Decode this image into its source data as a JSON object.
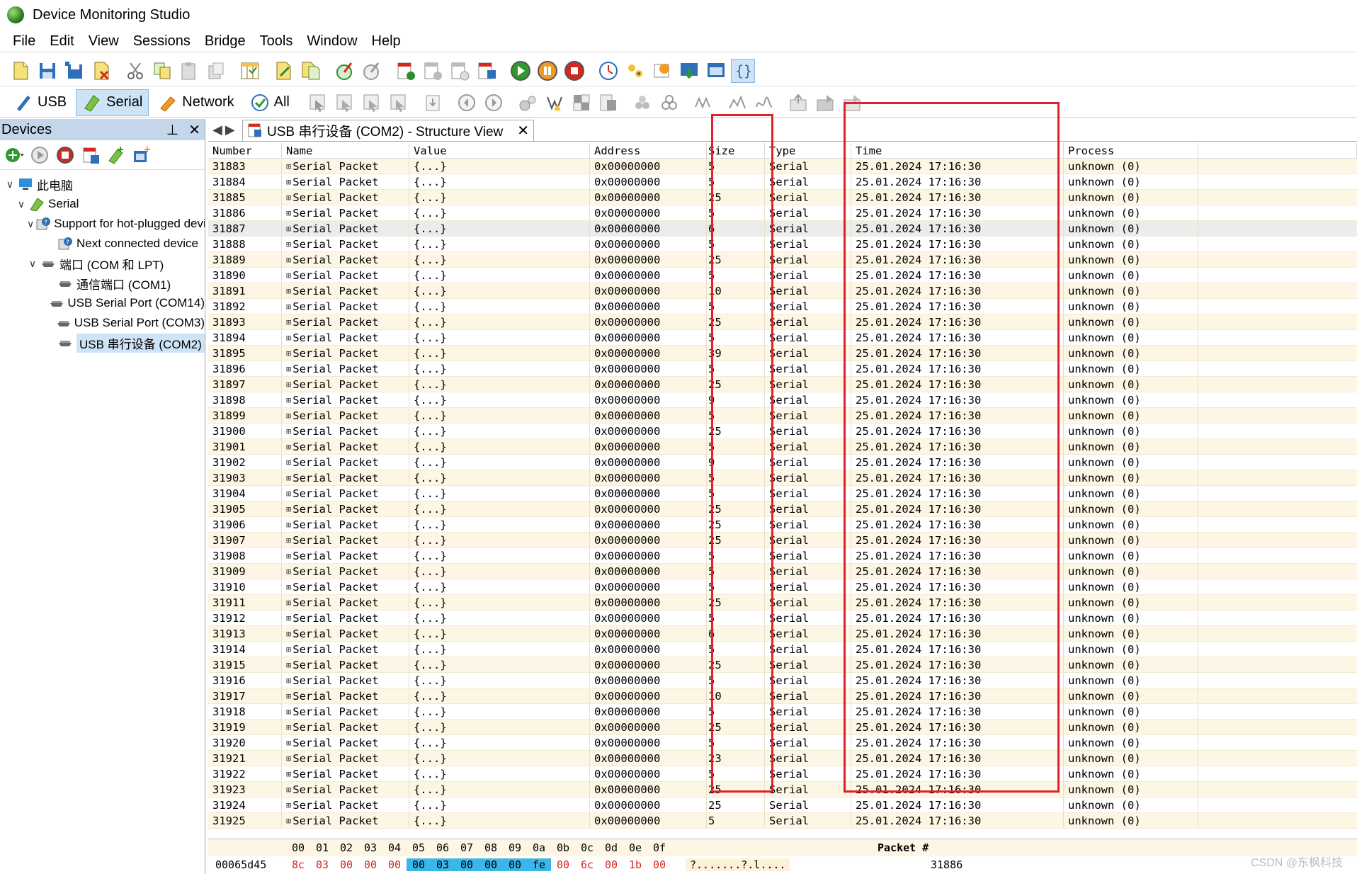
{
  "window": {
    "title": "Device Monitoring Studio"
  },
  "menu": [
    "File",
    "Edit",
    "View",
    "Sessions",
    "Bridge",
    "Tools",
    "Window",
    "Help"
  ],
  "filters": [
    {
      "label": "USB",
      "icon": "usb-icon",
      "active": false
    },
    {
      "label": "Serial",
      "icon": "serial-icon",
      "active": true
    },
    {
      "label": "Network",
      "icon": "network-icon",
      "active": false
    },
    {
      "label": "All",
      "icon": "check-all-icon",
      "active": false
    }
  ],
  "devices": {
    "header": "Devices",
    "pin": "⊥",
    "close": "✕",
    "tree": [
      {
        "label": "此电脑",
        "level": 0,
        "chev": "∨",
        "icon": "computer-icon"
      },
      {
        "label": "Serial",
        "level": 1,
        "chev": "∨",
        "icon": "serial-icon"
      },
      {
        "label": "Support for hot-plugged devices",
        "level": 2,
        "chev": "∨",
        "icon": "device-help-icon"
      },
      {
        "label": "Next connected device",
        "level": 3,
        "chev": "",
        "icon": "device-help-icon"
      },
      {
        "label": "端口 (COM 和 LPT)",
        "level": 2,
        "chev": "∨",
        "icon": "port-icon"
      },
      {
        "label": "通信端口 (COM1)",
        "level": 3,
        "chev": "",
        "icon": "port-icon"
      },
      {
        "label": "USB Serial Port (COM14)",
        "level": 3,
        "chev": "",
        "icon": "port-icon"
      },
      {
        "label": "USB Serial Port (COM3)",
        "level": 3,
        "chev": "",
        "icon": "port-icon"
      },
      {
        "label": "USB 串行设备 (COM2)",
        "level": 3,
        "chev": "",
        "icon": "port-icon",
        "selected": true
      }
    ]
  },
  "doc_tab": {
    "label": "USB 串行设备 (COM2) - Structure View",
    "close": "✕"
  },
  "grid": {
    "columns": [
      "Number",
      "Name",
      "Value",
      "Address",
      "Size",
      "Type",
      "Time",
      "Process"
    ],
    "name": "Serial Packet",
    "value": "{...}",
    "address": "0x00000000",
    "type": "Serial",
    "time": "25.01.2024 17:16:30",
    "process": "unknown (0)",
    "rows": [
      {
        "n": "31883",
        "s": "5"
      },
      {
        "n": "31884",
        "s": "5"
      },
      {
        "n": "31885",
        "s": "25"
      },
      {
        "n": "31886",
        "s": "5"
      },
      {
        "n": "31887",
        "s": "6"
      },
      {
        "n": "31888",
        "s": "5"
      },
      {
        "n": "31889",
        "s": "25"
      },
      {
        "n": "31890",
        "s": "5"
      },
      {
        "n": "31891",
        "s": "10"
      },
      {
        "n": "31892",
        "s": "5"
      },
      {
        "n": "31893",
        "s": "25"
      },
      {
        "n": "31894",
        "s": "5"
      },
      {
        "n": "31895",
        "s": "39"
      },
      {
        "n": "31896",
        "s": "5"
      },
      {
        "n": "31897",
        "s": "25"
      },
      {
        "n": "31898",
        "s": "9"
      },
      {
        "n": "31899",
        "s": "5"
      },
      {
        "n": "31900",
        "s": "25"
      },
      {
        "n": "31901",
        "s": "5"
      },
      {
        "n": "31902",
        "s": "9"
      },
      {
        "n": "31903",
        "s": "5"
      },
      {
        "n": "31904",
        "s": "5"
      },
      {
        "n": "31905",
        "s": "25"
      },
      {
        "n": "31906",
        "s": "25"
      },
      {
        "n": "31907",
        "s": "25"
      },
      {
        "n": "31908",
        "s": "5"
      },
      {
        "n": "31909",
        "s": "5"
      },
      {
        "n": "31910",
        "s": "5"
      },
      {
        "n": "31911",
        "s": "25"
      },
      {
        "n": "31912",
        "s": "5"
      },
      {
        "n": "31913",
        "s": "6"
      },
      {
        "n": "31914",
        "s": "5"
      },
      {
        "n": "31915",
        "s": "25"
      },
      {
        "n": "31916",
        "s": "5"
      },
      {
        "n": "31917",
        "s": "10"
      },
      {
        "n": "31918",
        "s": "5"
      },
      {
        "n": "31919",
        "s": "25"
      },
      {
        "n": "31920",
        "s": "5"
      },
      {
        "n": "31921",
        "s": "23"
      },
      {
        "n": "31922",
        "s": "5"
      },
      {
        "n": "31923",
        "s": "25"
      },
      {
        "n": "31924",
        "s": "25"
      },
      {
        "n": "31925",
        "s": "5"
      }
    ]
  },
  "hex": {
    "columns": [
      "00",
      "01",
      "02",
      "03",
      "04",
      "05",
      "06",
      "07",
      "08",
      "09",
      "0a",
      "0b",
      "0c",
      "0d",
      "0e",
      "0f"
    ],
    "offset": "00065d45",
    "bytes": [
      "8c",
      "03",
      "00",
      "00",
      "00",
      "00",
      "03",
      "00",
      "00",
      "00",
      "fe",
      "00",
      "6c",
      "00",
      "1b",
      "00"
    ],
    "ascii": "?.......?.l....",
    "packet_label": "Packet #",
    "packet_number": "31886"
  },
  "watermark": "CSDN @东枫科技",
  "colors": {
    "highlight_box": "#e0202a",
    "row_alt": "#fdf6e5",
    "hex_select": "#3bb6e8"
  }
}
